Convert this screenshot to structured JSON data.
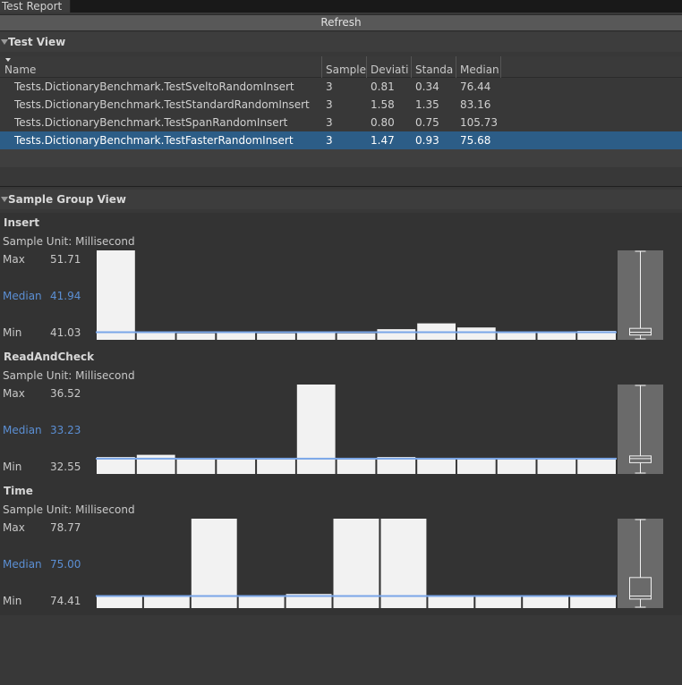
{
  "window": {
    "tab_title": "Test Report"
  },
  "toolbar": {
    "refresh_label": "Refresh"
  },
  "test_view": {
    "title": "Test View",
    "columns": [
      "Name",
      "Sample",
      "Deviati",
      "Standa",
      "Median"
    ],
    "rows": [
      {
        "name": "Tests.DictionaryBenchmark.TestSveltoRandomInsert",
        "sample": "3",
        "deviation": "0.81",
        "standard": "0.34",
        "median": "76.44"
      },
      {
        "name": "Tests.DictionaryBenchmark.TestStandardRandomInsert",
        "sample": "3",
        "deviation": "1.58",
        "standard": "1.35",
        "median": "83.16"
      },
      {
        "name": "Tests.DictionaryBenchmark.TestSpanRandomInsert",
        "sample": "3",
        "deviation": "0.80",
        "standard": "0.75",
        "median": "105.73"
      },
      {
        "name": "Tests.DictionaryBenchmark.TestFasterRandomInsert",
        "sample": "3",
        "deviation": "1.47",
        "standard": "0.93",
        "median": "75.68"
      }
    ],
    "selected_row": 3
  },
  "sample_group_view": {
    "title": "Sample Group View",
    "labels": {
      "max": "Max",
      "median": "Median",
      "min": "Min"
    },
    "colors": {
      "bar": "#f2f2f2",
      "median_line": "#7aa6e8",
      "median_text": "#5b8fd4",
      "panel": "#333333",
      "boxplot_bg": "#6a6a6a"
    }
  },
  "chart_data": [
    {
      "type": "bar",
      "title": "Insert",
      "unit_label": "Sample Unit: Millisecond",
      "max": "51.71",
      "median": "41.94",
      "min": "41.03",
      "ylim": [
        41.03,
        51.71
      ],
      "median_value": 41.94,
      "values": [
        51.71,
        42.0,
        41.8,
        41.9,
        41.8,
        41.9,
        41.8,
        42.3,
        43.0,
        42.5,
        41.9,
        41.9,
        42.1
      ],
      "boxplot": {
        "min": 41.03,
        "q1": 41.6,
        "median": 41.94,
        "q3": 42.4,
        "max": 51.71
      }
    },
    {
      "type": "bar",
      "title": "ReadAndCheck",
      "unit_label": "Sample Unit: Millisecond",
      "max": "36.52",
      "median": "33.23",
      "min": "32.55",
      "ylim": [
        32.55,
        36.52
      ],
      "median_value": 33.23,
      "values": [
        33.3,
        33.4,
        33.2,
        33.2,
        33.2,
        36.52,
        33.2,
        33.3,
        33.2,
        33.2,
        33.2,
        33.2,
        33.2
      ],
      "boxplot": {
        "min": 32.55,
        "q1": 33.05,
        "median": 33.23,
        "q3": 33.35,
        "max": 36.52
      }
    },
    {
      "type": "bar",
      "title": "Time",
      "unit_label": "Sample Unit: Millisecond",
      "max": "78.77",
      "median": "75.00",
      "min": "74.41",
      "ylim": [
        74.41,
        78.77
      ],
      "median_value": 75.0,
      "values": [
        75.0,
        75.0,
        78.77,
        75.0,
        75.1,
        78.77,
        78.77,
        75.0,
        75.0,
        75.0,
        75.0
      ],
      "boxplot": {
        "min": 74.41,
        "q1": 74.85,
        "median": 75.0,
        "q3": 75.9,
        "max": 78.77
      }
    }
  ]
}
